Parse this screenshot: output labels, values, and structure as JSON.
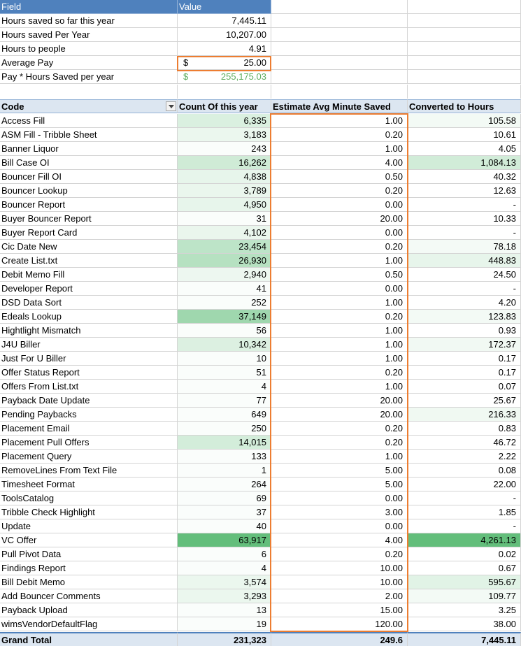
{
  "summary": {
    "header": {
      "field": "Field",
      "value": "Value"
    },
    "rows": [
      {
        "label": "Hours saved so far this year",
        "value": "7,445.11",
        "currency": ""
      },
      {
        "label": "Hours saved Per Year",
        "value": "10,207.00",
        "currency": ""
      },
      {
        "label": "Hours to people",
        "value": "4.91",
        "currency": ""
      },
      {
        "label": "Average Pay",
        "value": "25.00",
        "currency": "$"
      },
      {
        "label": "Pay * Hours Saved per year",
        "value": "255,175.03",
        "currency": "$"
      }
    ]
  },
  "pivot": {
    "headers": {
      "code": "Code",
      "count": "Count Of this year",
      "minutes": "Estimate Avg Minute Saved",
      "hours": "Converted to Hours"
    },
    "rows": [
      {
        "code": "Access Fill",
        "count": "6,335",
        "count_level": 0.17,
        "minutes": "1.00",
        "hours": "105.58",
        "hours_level": 0.02
      },
      {
        "code": "ASM Fill - Tribble Sheet",
        "count": "3,183",
        "count_level": 0.05,
        "minutes": "0.20",
        "hours": "10.61",
        "hours_level": 0
      },
      {
        "code": "Banner Liquor",
        "count": "243",
        "count_level": 0,
        "minutes": "1.00",
        "hours": "4.05",
        "hours_level": 0
      },
      {
        "code": "Bill Case OI",
        "count": "16,262",
        "count_level": 0.25,
        "minutes": "4.00",
        "hours": "1,084.13",
        "hours_level": 0.25
      },
      {
        "code": "Bouncer Fill OI",
        "count": "4,838",
        "count_level": 0.08,
        "minutes": "0.50",
        "hours": "40.32",
        "hours_level": 0
      },
      {
        "code": "Bouncer Lookup",
        "count": "3,789",
        "count_level": 0.06,
        "minutes": "0.20",
        "hours": "12.63",
        "hours_level": 0
      },
      {
        "code": "Bouncer Report",
        "count": "4,950",
        "count_level": 0.08,
        "minutes": "0.00",
        "hours": "-",
        "hours_level": 0
      },
      {
        "code": "Buyer Bouncer Report",
        "count": "31",
        "count_level": 0,
        "minutes": "20.00",
        "hours": "10.33",
        "hours_level": 0
      },
      {
        "code": "Buyer Report Card",
        "count": "4,102",
        "count_level": 0.06,
        "minutes": "0.00",
        "hours": "-",
        "hours_level": 0
      },
      {
        "code": "Cic Date New",
        "count": "23,454",
        "count_level": 0.37,
        "minutes": "0.20",
        "hours": "78.18",
        "hours_level": 0.01
      },
      {
        "code": "Create List.txt",
        "count": "26,930",
        "count_level": 0.42,
        "minutes": "1.00",
        "hours": "448.83",
        "hours_level": 0.1
      },
      {
        "code": "Debit Memo Fill",
        "count": "2,940",
        "count_level": 0.04,
        "minutes": "0.50",
        "hours": "24.50",
        "hours_level": 0
      },
      {
        "code": "Developer Report",
        "count": "41",
        "count_level": 0,
        "minutes": "0.00",
        "hours": "-",
        "hours_level": 0
      },
      {
        "code": "DSD Data Sort",
        "count": "252",
        "count_level": 0,
        "minutes": "1.00",
        "hours": "4.20",
        "hours_level": 0
      },
      {
        "code": "Edeals Lookup",
        "count": "37,149",
        "count_level": 0.58,
        "minutes": "0.20",
        "hours": "123.83",
        "hours_level": 0.02
      },
      {
        "code": "Hightlight Mismatch",
        "count": "56",
        "count_level": 0,
        "minutes": "1.00",
        "hours": "0.93",
        "hours_level": 0
      },
      {
        "code": "J4U Biller",
        "count": "10,342",
        "count_level": 0.16,
        "minutes": "1.00",
        "hours": "172.37",
        "hours_level": 0.03
      },
      {
        "code": "Just For U Biller",
        "count": "10",
        "count_level": 0,
        "minutes": "1.00",
        "hours": "0.17",
        "hours_level": 0
      },
      {
        "code": "Offer Status Report",
        "count": "51",
        "count_level": 0,
        "minutes": "0.20",
        "hours": "0.17",
        "hours_level": 0
      },
      {
        "code": "Offers From List.txt",
        "count": "4",
        "count_level": 0,
        "minutes": "1.00",
        "hours": "0.07",
        "hours_level": 0
      },
      {
        "code": "Payback Date Update",
        "count": "77",
        "count_level": 0,
        "minutes": "20.00",
        "hours": "25.67",
        "hours_level": 0
      },
      {
        "code": "Pending Paybacks",
        "count": "649",
        "count_level": 0,
        "minutes": "20.00",
        "hours": "216.33",
        "hours_level": 0.04
      },
      {
        "code": "Placement Email",
        "count": "250",
        "count_level": 0,
        "minutes": "0.20",
        "hours": "0.83",
        "hours_level": 0
      },
      {
        "code": "Placement Pull Offers",
        "count": "14,015",
        "count_level": 0.22,
        "minutes": "0.20",
        "hours": "46.72",
        "hours_level": 0
      },
      {
        "code": "Placement Query",
        "count": "133",
        "count_level": 0,
        "minutes": "1.00",
        "hours": "2.22",
        "hours_level": 0
      },
      {
        "code": "RemoveLines From Text File",
        "count": "1",
        "count_level": 0,
        "minutes": "5.00",
        "hours": "0.08",
        "hours_level": 0
      },
      {
        "code": "Timesheet Format",
        "count": "264",
        "count_level": 0,
        "minutes": "5.00",
        "hours": "22.00",
        "hours_level": 0
      },
      {
        "code": "ToolsCatalog",
        "count": "69",
        "count_level": 0,
        "minutes": "0.00",
        "hours": "-",
        "hours_level": 0
      },
      {
        "code": "Tribble Check Highlight",
        "count": "37",
        "count_level": 0,
        "minutes": "3.00",
        "hours": "1.85",
        "hours_level": 0
      },
      {
        "code": "Update",
        "count": "40",
        "count_level": 0,
        "minutes": "0.00",
        "hours": "-",
        "hours_level": 0
      },
      {
        "code": "VC Offer",
        "count": "63,917",
        "count_level": 1.0,
        "minutes": "4.00",
        "hours": "4,261.13",
        "hours_level": 1.0
      },
      {
        "code": "Pull Pivot Data",
        "count": "6",
        "count_level": 0,
        "minutes": "0.20",
        "hours": "0.02",
        "hours_level": 0
      },
      {
        "code": "Findings Report",
        "count": "4",
        "count_level": 0,
        "minutes": "10.00",
        "hours": "0.67",
        "hours_level": 0
      },
      {
        "code": "Bill Debit Memo",
        "count": "3,574",
        "count_level": 0.05,
        "minutes": "10.00",
        "hours": "595.67",
        "hours_level": 0.14
      },
      {
        "code": "Add Bouncer Comments",
        "count": "3,293",
        "count_level": 0.05,
        "minutes": "2.00",
        "hours": "109.77",
        "hours_level": 0.02
      },
      {
        "code": "Payback Upload",
        "count": "13",
        "count_level": 0,
        "minutes": "15.00",
        "hours": "3.25",
        "hours_level": 0
      },
      {
        "code": "wimsVendorDefaultFlag",
        "count": "19",
        "count_level": 0,
        "minutes": "120.00",
        "hours": "38.00",
        "hours_level": 0
      }
    ],
    "total": {
      "label": "Grand Total",
      "count": "231,323",
      "minutes": "249.6",
      "hours": "7,445.11"
    }
  },
  "colors": {
    "header_blue": "#4f81bd",
    "pivot_header": "#dce6f1",
    "highlight_border": "#ed7d31",
    "scale_high": "#63be7b",
    "scale_low": "#ffffff",
    "currency_green": "#5fae5f"
  }
}
